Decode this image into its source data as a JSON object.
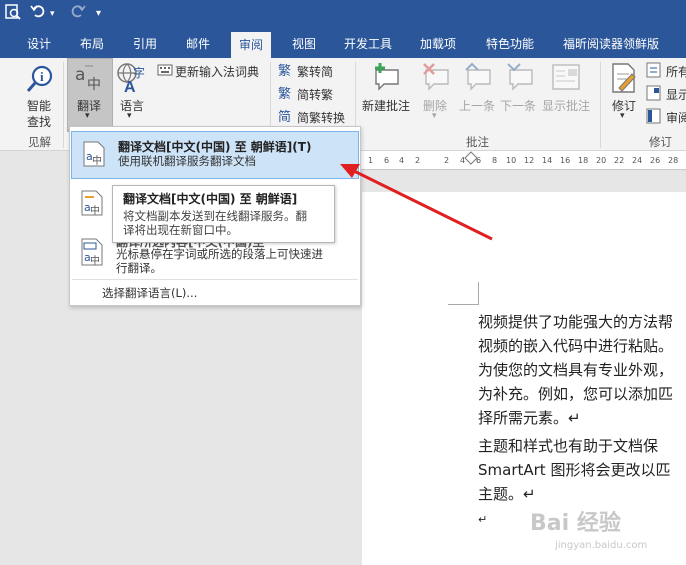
{
  "quick_access": {
    "undo_icon": "undo-icon",
    "redo_icon": "redo-icon",
    "customize_icon": "chevron-down-icon",
    "app_icon": "print-preview-icon"
  },
  "tabs": [
    "设计",
    "布局",
    "引用",
    "邮件",
    "审阅",
    "视图",
    "开发工具",
    "加载项",
    "特色功能",
    "福昕阅读器领鲜版"
  ],
  "active_tab": "审阅",
  "ribbon": {
    "smart_lookup": {
      "line1": "智能",
      "line2": "查找"
    },
    "group_insights": "见解",
    "translate": "翻译",
    "language": "语言",
    "update_ime": "更新输入法词典",
    "trad_to_simp": "繁转简",
    "simp_to_trad": "简转繁",
    "convert": "简繁转换",
    "new_comment": "新建批注",
    "delete": "删除",
    "prev": "上一条",
    "next": "下一条",
    "show_comments": "显示批注",
    "group_comments": "批注",
    "track_changes": "修订",
    "group_tracking": "修订",
    "markup_all": "所有",
    "show_markup": "显示",
    "reviewing_pane": "审阅"
  },
  "menu": {
    "item1_title": "翻译文档[中文(中国) 至 朝鲜语](T)",
    "item1_desc": "使用联机翻译服务翻译文档",
    "item3_title": "翻译所选内容[中文(中国)至",
    "item3_desc1": "光标悬停在字词或所选的段落上可快速进",
    "item3_desc2": "行翻译。",
    "choose_language": "选择翻译语言(L)..."
  },
  "tooltip": {
    "title": "翻译文档[中文(中国) 至 朝鲜语]",
    "line1": "将文档副本发送到在线翻译服务。翻",
    "line2": "译将出现在新窗口中。"
  },
  "document": {
    "lines": [
      "视频提供了功能强大的方法帮",
      "视频的嵌入代码中进行粘贴。",
      "为使您的文档具有专业外观，",
      "为补充。例如，您可以添加匹",
      "择所需元素。↵",
      "主题和样式也有助于文档保",
      "SmartArt 图形将会更改以匹",
      "主题。↵",
      "↵"
    ]
  },
  "watermark": {
    "main": "Bai 经验",
    "sub": "jingyan.baidu.com"
  },
  "colors": {
    "brand": "#2b579a",
    "arrow": "#e02020",
    "highlight": "#cde3f7"
  }
}
